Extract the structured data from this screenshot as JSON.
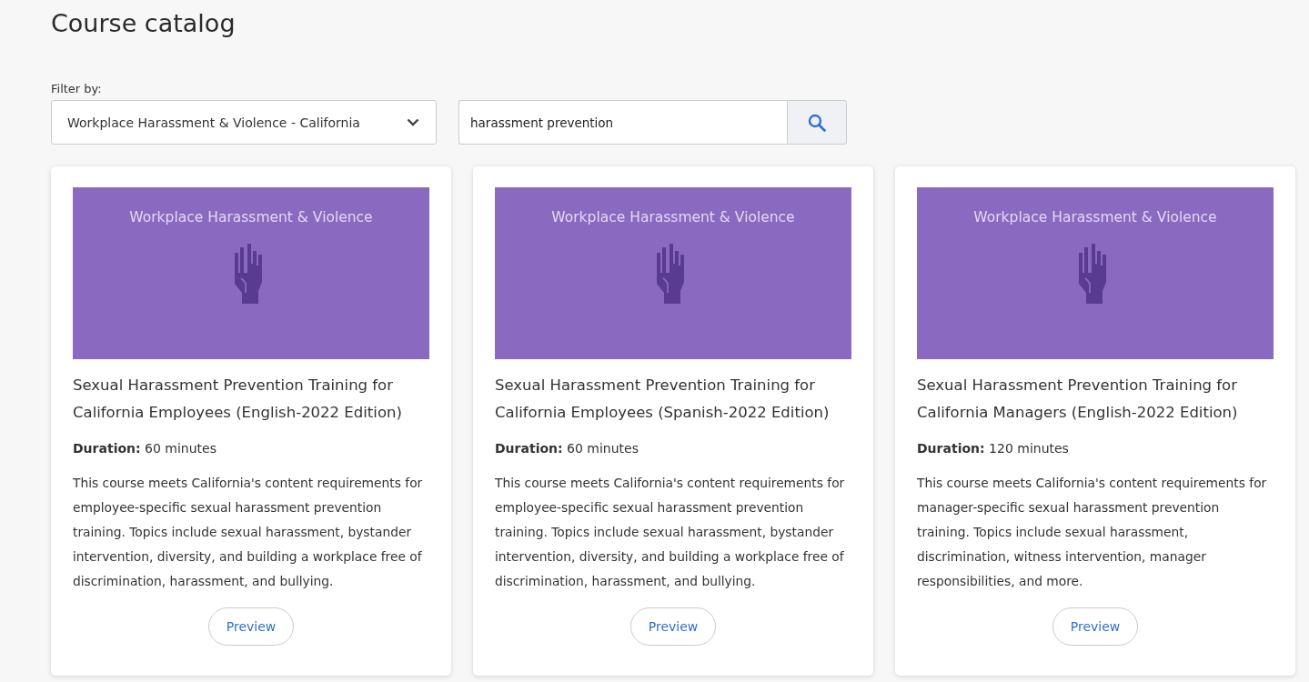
{
  "page_title": "Course catalog",
  "filter": {
    "label": "Filter by:",
    "value": "Workplace Harassment & Violence - California"
  },
  "search": {
    "value": "harassment prevention"
  },
  "courses": [
    {
      "banner": "Workplace Harassment & Violence",
      "title": "Sexual Harassment Prevention Training for California Employees (English-2022 Edition)",
      "duration": "**Duration:** 60 minutes",
      "description": "This course meets California's content requirements for employee-specific sexual harassment prevention training. Topics include sexual harassment, bystander intervention, diversity, and building a workplace free of discrimination, harassment, and bullying.",
      "button": "Preview"
    },
    {
      "banner": "Workplace Harassment & Violence",
      "title": "Sexual Harassment Prevention Training for California Employees (Spanish-2022 Edition)",
      "duration": "**Duration:** 60 minutes",
      "description": "This course meets California's content requirements for employee-specific sexual harassment prevention training. Topics include sexual harassment, bystander intervention, diversity, and building a workplace free of discrimination, harassment, and bullying.",
      "button": "Preview"
    },
    {
      "banner": "Workplace Harassment & Violence",
      "title": "Sexual Harassment Prevention Training for California Managers (English-2022 Edition)",
      "duration": "**Duration:** 120 minutes",
      "description": "This course meets California's content requirements for manager-specific sexual harassment prevention training. Topics include sexual harassment, discrimination, witness intervention, manager responsibilities, and more.",
      "button": "Preview"
    }
  ]
}
